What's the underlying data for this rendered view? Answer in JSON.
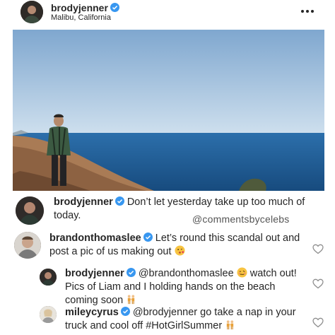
{
  "header": {
    "username": "brodyjenner",
    "location": "Malibu, California"
  },
  "caption": {
    "username": "brodyjenner",
    "text": "Don’t let yesterday take up too much of today."
  },
  "watermark": "@commentsbycelebs",
  "comments": [
    {
      "username": "brandonthomaslee",
      "text": "Let’s round this scandal out and post a pic of us making out",
      "emoji": "kissing-face"
    },
    {
      "username": "brodyjenner",
      "mention": "@brandonthomaslee",
      "text_after": "watch out! Pics of Liam and I holding hands on the beach coming soon",
      "emoji1": "woozy-face",
      "emoji2": "two-women-holding-hands"
    },
    {
      "username": "mileycyrus",
      "text": "@brodyjenner go take a nap in your truck and cool off #HotGirlSummer",
      "emoji": "two-women-holding-hands"
    }
  ],
  "colors": {
    "verified_blue": "#3897f0",
    "text": "#262626",
    "sky": "#9ec0dc",
    "ocean": "#1f5f96"
  }
}
